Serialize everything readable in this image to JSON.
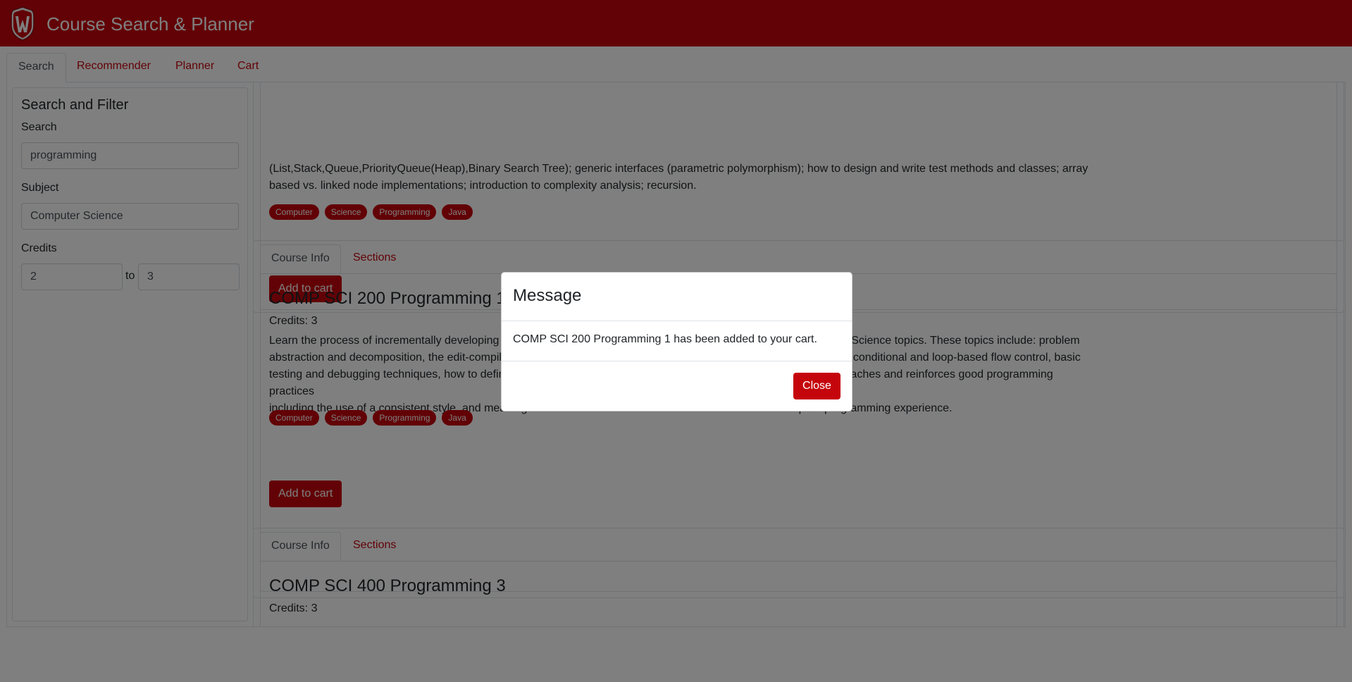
{
  "header": {
    "title": "Course Search & Planner"
  },
  "nav": {
    "tabs": [
      {
        "label": "Search",
        "active": true
      },
      {
        "label": "Recommender"
      },
      {
        "label": "Planner"
      },
      {
        "label": "Cart"
      }
    ]
  },
  "filters": {
    "title": "Search and Filter",
    "search_label": "Search",
    "search_value": "programming",
    "subject_label": "Subject",
    "subject_value": "Computer Science",
    "credits_label": "Credits",
    "credits_min": "2",
    "credits_to": "to",
    "credits_max": "3"
  },
  "courses": [
    {
      "description_lines": [
        "(List,Stack,Queue,PriorityQueue(Heap),Binary Search Tree); generic interfaces (parametric polymorphism); how to design and write test methods and classes; array",
        "based vs. linked node implementations; introduction to complexity analysis; recursion."
      ],
      "tags": [
        "Computer",
        "Science",
        "Programming",
        "Java"
      ],
      "add_label": "Add to cart"
    },
    {
      "tab_info": "Course Info",
      "tab_sections": "Sections",
      "title": "COMP SCI 200 Programming 1",
      "credits": "Credits: 3",
      "description_lines": [
        "Learn the process of incrementally developing small (200-500 lines) programs along with the fundamental Computer Science topics. These topics include: problem",
        "abstraction and decomposition, the edit-compile-run cycle, using variables of primitive and more complex data types, conditional and loop-based flow control, basic",
        "testing and debugging techniques, how to define and call functions (methods), and IO processing techniques. Also teaches and reinforces good programming practices",
        "including the use of a consistent style, and meaningful documentation. Intended for students who have no prior programming experience."
      ],
      "tags": [
        "Computer",
        "Science",
        "Programming",
        "Java"
      ],
      "add_label": "Add to cart"
    },
    {
      "tab_info": "Course Info",
      "tab_sections": "Sections",
      "title": "COMP SCI 400 Programming 3",
      "credits": "Credits: 3"
    }
  ],
  "modal": {
    "title": "Message",
    "body": "COMP SCI 200 Programming 1 has been added to your cart.",
    "close_label": "Close"
  },
  "colors": {
    "brand": "#c5050c",
    "overlay": "rgba(0,0,0,0.5)"
  },
  "icons": {
    "logo": "uw-crest-icon"
  }
}
